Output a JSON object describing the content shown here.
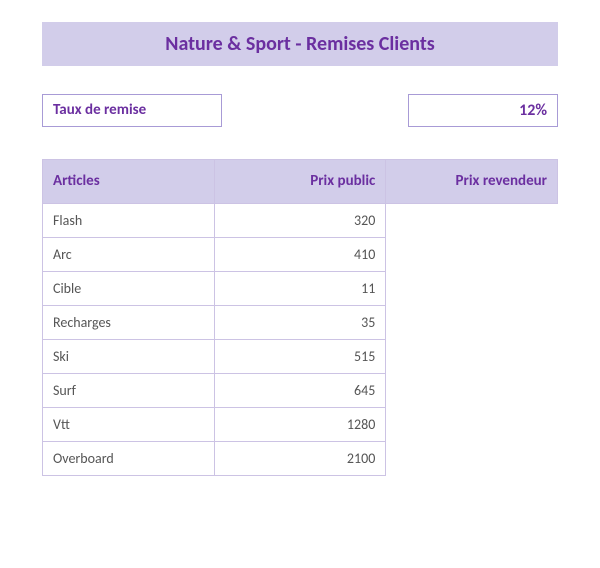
{
  "title": "Nature & Sport - Remises Clients",
  "rate": {
    "label": "Taux de remise",
    "value": "12%"
  },
  "table": {
    "headers": {
      "article": "Articles",
      "public": "Prix public",
      "reseller": "Prix revendeur"
    },
    "rows": [
      {
        "article": "Flash",
        "public": "320"
      },
      {
        "article": "Arc",
        "public": "410"
      },
      {
        "article": "Cible",
        "public": "11"
      },
      {
        "article": "Recharges",
        "public": "35"
      },
      {
        "article": "Ski",
        "public": "515"
      },
      {
        "article": "Surf",
        "public": "645"
      },
      {
        "article": "Vtt",
        "public": "1280"
      },
      {
        "article": "Overboard",
        "public": "2100"
      }
    ]
  },
  "chart_data": {
    "type": "table",
    "title": "Nature & Sport - Remises Clients",
    "discount_rate_percent": 12,
    "columns": [
      "Articles",
      "Prix public",
      "Prix revendeur"
    ],
    "rows": [
      [
        "Flash",
        320,
        null
      ],
      [
        "Arc",
        410,
        null
      ],
      [
        "Cible",
        11,
        null
      ],
      [
        "Recharges",
        35,
        null
      ],
      [
        "Ski",
        515,
        null
      ],
      [
        "Surf",
        645,
        null
      ],
      [
        "Vtt",
        1280,
        null
      ],
      [
        "Overboard",
        2100,
        null
      ]
    ]
  }
}
